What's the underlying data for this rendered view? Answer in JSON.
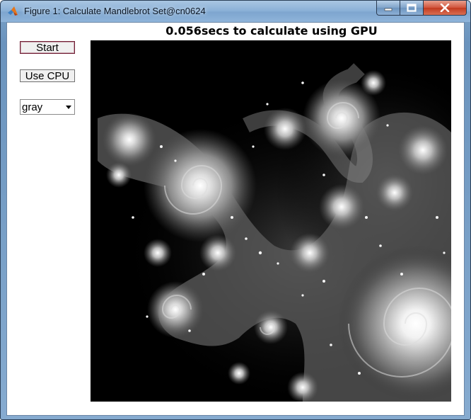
{
  "window": {
    "title": "Figure 1: Calculate Mandlebrot Set@cn0624",
    "icon": "matlab-icon"
  },
  "controls": {
    "start_label": "Start",
    "cpu_label": "Use CPU",
    "colormap_value": "gray"
  },
  "plot": {
    "title": "0.056secs to calculate using GPU",
    "colormap": "gray",
    "background": "#000000"
  }
}
